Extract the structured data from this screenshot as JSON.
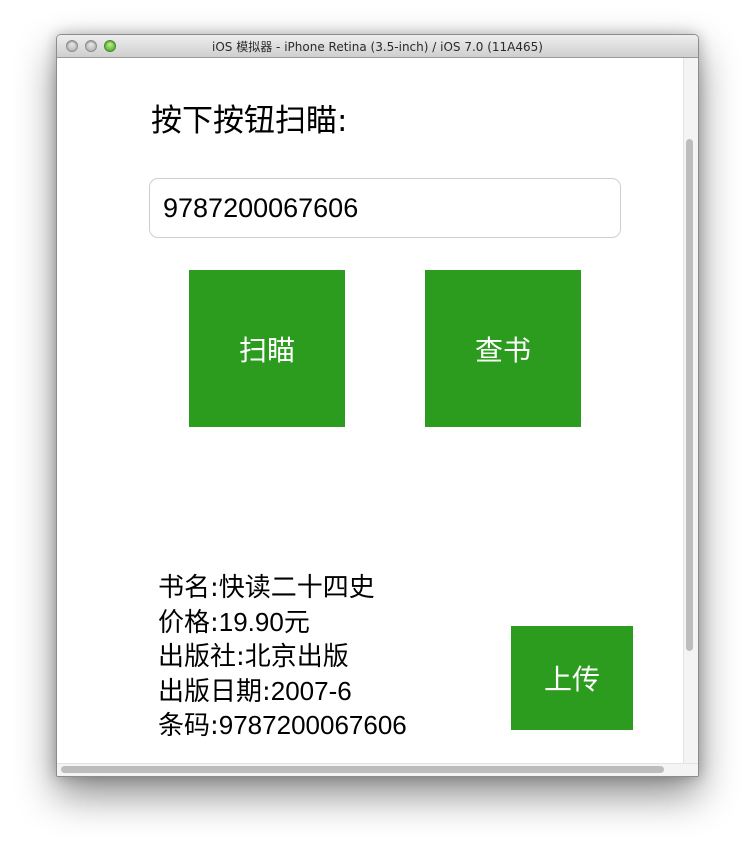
{
  "window": {
    "title": "iOS 模拟器 - iPhone Retina (3.5-inch) / iOS 7.0 (11A465)"
  },
  "app": {
    "prompt_label": "按下按钮扫瞄:",
    "barcode_input_value": "9787200067606",
    "scan_button_label": "扫瞄",
    "lookup_button_label": "查书",
    "upload_button_label": "上传",
    "accent_color": "#2c9c1e",
    "book_info": [
      {
        "label": "书名:",
        "value": "快读二十四史"
      },
      {
        "label": "价格:",
        "value": "19.90元"
      },
      {
        "label": "出版社:",
        "value": "北京出版"
      },
      {
        "label": "出版日期:",
        "value": "2007-6"
      },
      {
        "label": "条码:",
        "value": "9787200067606"
      }
    ]
  }
}
